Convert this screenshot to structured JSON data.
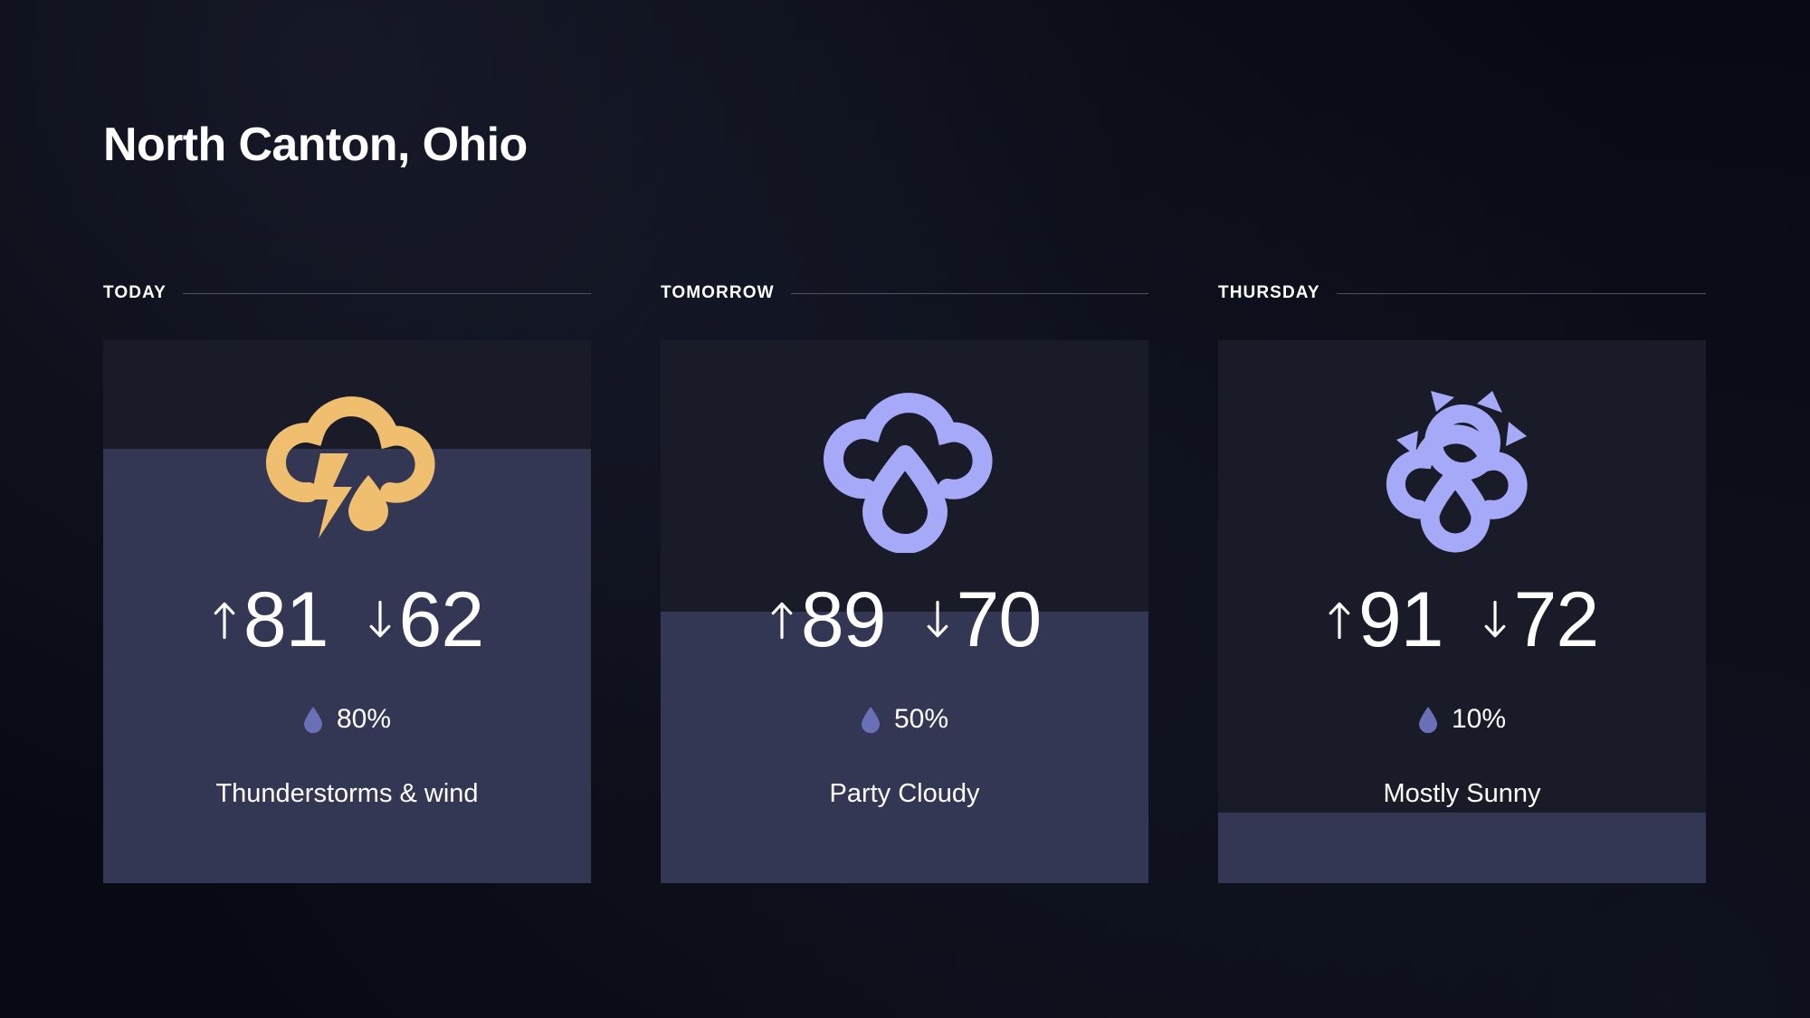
{
  "location": {
    "title": "North Canton, Ohio"
  },
  "theme": {
    "page_background": "#0a0c16",
    "card_background": "#191b29",
    "card_fill": "#343754",
    "text_primary": "#ffffff",
    "rule_color": "#6f7490",
    "accent_storm": "#efbe6e",
    "accent_rain": "#a5a9f7",
    "accent_drop": "#6b6fb5"
  },
  "forecast": [
    {
      "day_label": "TODAY",
      "icon": "thunderstorm-icon",
      "icon_color": "#efbe6e",
      "high_label": "81",
      "low_label": "62",
      "high_arrow": "arrow-up-icon",
      "low_arrow": "arrow-down-icon",
      "precip_icon": "water-drop-icon",
      "precip_label": "80%",
      "precip_value": 80,
      "summary": "Thunderstorms & wind"
    },
    {
      "day_label": "TOMORROW",
      "icon": "rain-cloud-icon",
      "icon_color": "#a5a9f7",
      "high_label": "89",
      "low_label": "70",
      "high_arrow": "arrow-up-icon",
      "low_arrow": "arrow-down-icon",
      "precip_icon": "water-drop-icon",
      "precip_label": "50%",
      "precip_value": 50,
      "summary": "Party Cloudy"
    },
    {
      "day_label": "THURSDAY",
      "icon": "sun-cloud-rain-icon",
      "icon_color": "#a5a9f7",
      "high_label": "91",
      "low_label": "72",
      "high_arrow": "arrow-up-icon",
      "low_arrow": "arrow-down-icon",
      "precip_icon": "water-drop-icon",
      "precip_label": "10%",
      "precip_value": 10,
      "summary": "Mostly Sunny"
    }
  ]
}
